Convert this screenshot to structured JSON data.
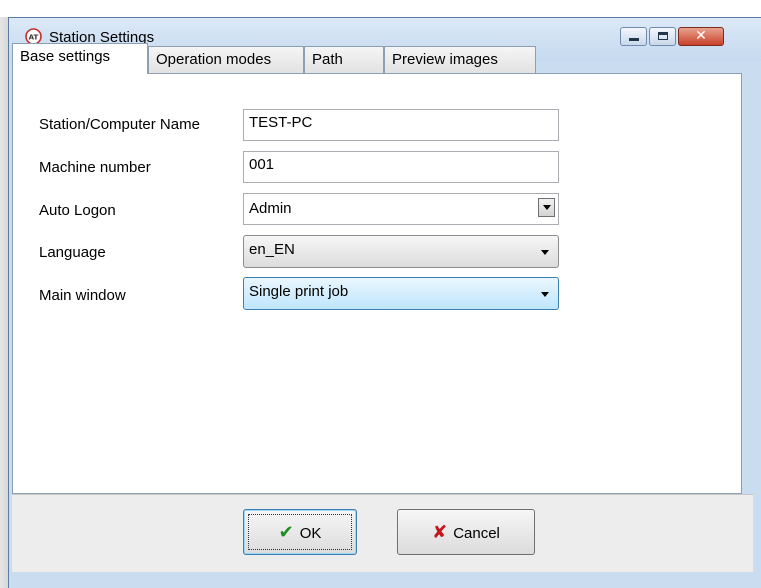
{
  "window": {
    "title": "Station Settings",
    "icon": "station-settings-app-icon",
    "controls": {
      "minimize": "minimize",
      "maximize": "maximize",
      "close": "✕"
    }
  },
  "tabs": [
    {
      "label": "Base settings",
      "active": true
    },
    {
      "label": "Operation modes",
      "active": false
    },
    {
      "label": "Path",
      "active": false
    },
    {
      "label": "Preview images",
      "active": false
    }
  ],
  "form": {
    "station_name": {
      "label": "Station/Computer Name",
      "value": "TEST-PC"
    },
    "machine_number": {
      "label": "Machine number",
      "value": "001"
    },
    "auto_logon": {
      "label": "Auto Logon",
      "value": "Admin"
    },
    "language": {
      "label": "Language",
      "value": "en_EN"
    },
    "main_window": {
      "label": "Main window",
      "value": "Single print job"
    }
  },
  "buttons": {
    "ok": {
      "label": "OK",
      "icon": "checkmark-icon"
    },
    "cancel": {
      "label": "Cancel",
      "icon": "x-icon"
    }
  },
  "colors": {
    "titlebar": "#c5d9ef",
    "close_button": "#c7422a",
    "ok_icon": "#1f8d1f",
    "cancel_icon": "#c4161c",
    "focus_border": "#3c7fb1"
  }
}
